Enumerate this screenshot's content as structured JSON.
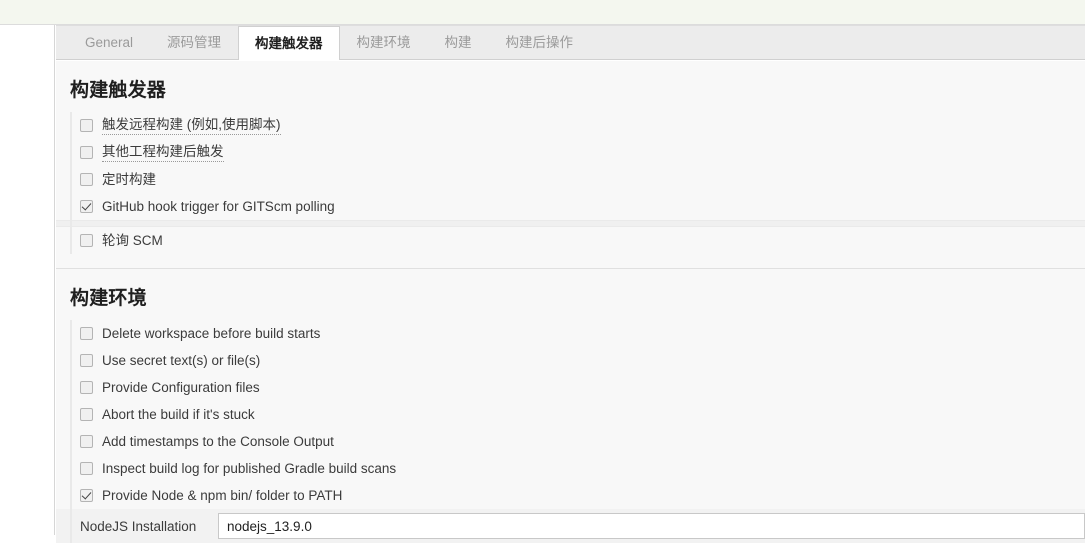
{
  "tabs": [
    {
      "label": "General",
      "active": false
    },
    {
      "label": "源码管理",
      "active": false
    },
    {
      "label": "构建触发器",
      "active": true
    },
    {
      "label": "构建环境",
      "active": false
    },
    {
      "label": "构建",
      "active": false
    },
    {
      "label": "构建后操作",
      "active": false
    }
  ],
  "sections": [
    {
      "title": "构建触发器",
      "options": [
        {
          "label": "触发远程构建 (例如,使用脚本)",
          "checked": false,
          "help": true
        },
        {
          "label": "其他工程构建后触发",
          "checked": false,
          "help": true
        },
        {
          "label": "定时构建",
          "checked": false,
          "help": false
        },
        {
          "label": "GitHub hook trigger for GITScm polling",
          "checked": true,
          "help": false
        },
        {
          "label": "轮询 SCM",
          "checked": false,
          "help": false
        }
      ]
    },
    {
      "title": "构建环境",
      "options": [
        {
          "label": "Delete workspace before build starts",
          "checked": false,
          "help": false
        },
        {
          "label": "Use secret text(s) or file(s)",
          "checked": false,
          "help": false
        },
        {
          "label": "Provide Configuration files",
          "checked": false,
          "help": false
        },
        {
          "label": "Abort the build if it's stuck",
          "checked": false,
          "help": false
        },
        {
          "label": "Add timestamps to the Console Output",
          "checked": false,
          "help": false
        },
        {
          "label": "Inspect build log for published Gradle build scans",
          "checked": false,
          "help": false
        },
        {
          "label": "Provide Node & npm bin/ folder to PATH",
          "checked": true,
          "help": false
        }
      ],
      "field": {
        "label": "NodeJS Installation",
        "value": "nodejs_13.9.0"
      }
    }
  ],
  "colors": {
    "top_strip": "#f4f7ef",
    "tab_bar": "#ececec",
    "panel_bg": "#f8f8f8",
    "active_tab_bg": "#ffffff",
    "label_text": "#3b3b3b",
    "inactive_tab_text": "#9a9a9a"
  }
}
